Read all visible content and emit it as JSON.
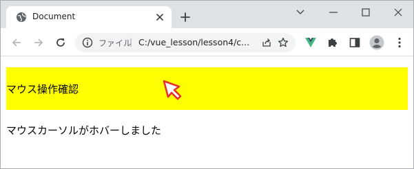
{
  "tab": {
    "title": "Document",
    "favicon_icon": "globe-icon",
    "close_icon": "close-icon"
  },
  "toolbar": {
    "new_tab_icon": "plus-icon",
    "back_icon": "arrow-left-icon",
    "forward_icon": "arrow-right-icon",
    "reload_icon": "reload-icon"
  },
  "omnibox": {
    "scheme_label": "ファイル",
    "separator": "|",
    "url": "C:/vue_lesson/lesson4/c...",
    "site_info_icon": "info-icon",
    "share_icon": "share-icon",
    "bookmark_icon": "star-icon"
  },
  "extensions": [
    "vue-devtools-icon",
    "puzzle-icon",
    "side-panel-icon",
    "avatar-icon",
    "menu-icon"
  ],
  "window_controls": [
    "chevron-down-icon",
    "minimize-icon",
    "maximize-icon",
    "close-icon"
  ],
  "page": {
    "hover_box_text": "マウス操作確認",
    "hover_box_color": "#ffff00",
    "status_text": "マウスカーソルがホバーしました"
  }
}
